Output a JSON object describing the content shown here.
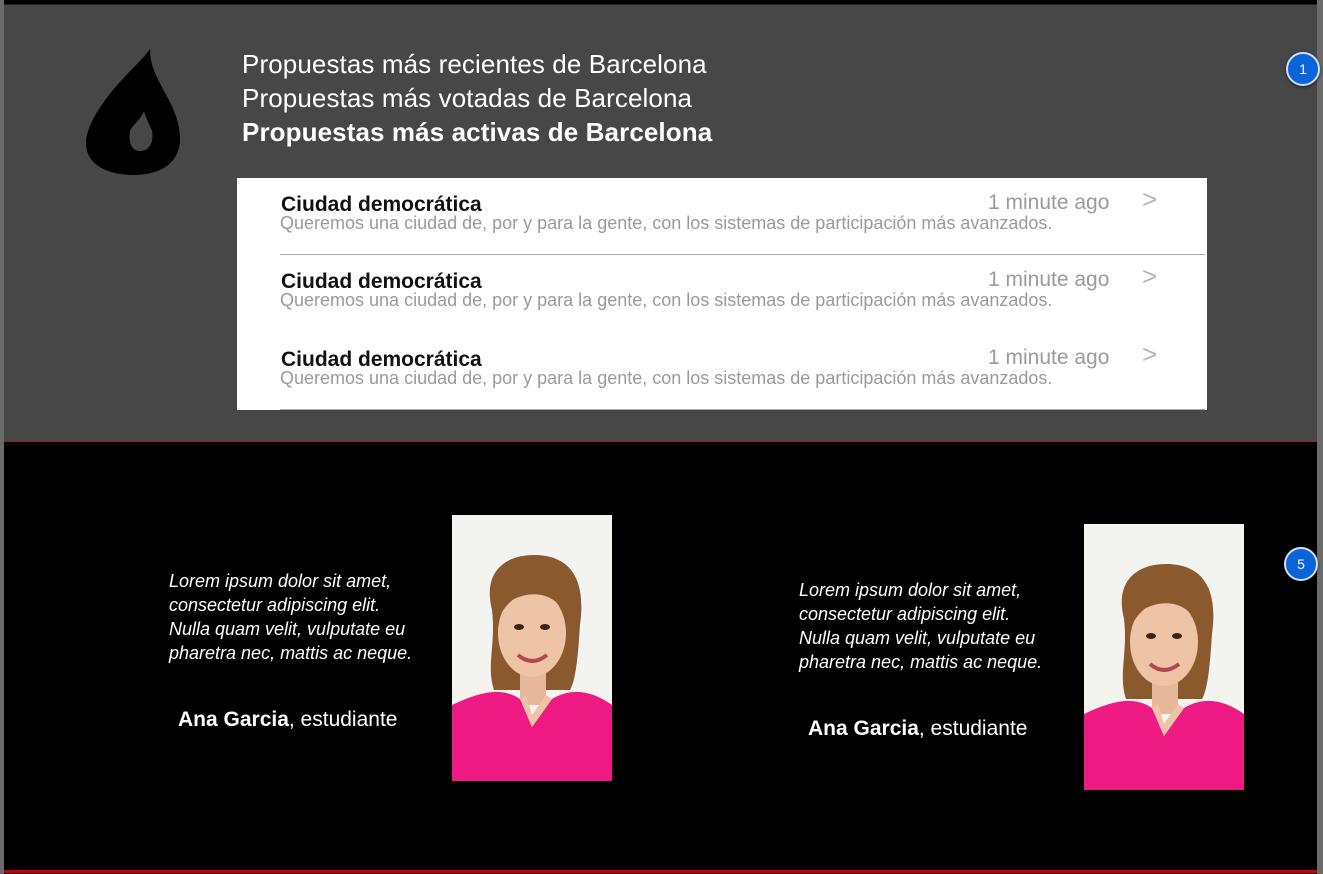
{
  "headings": [
    "Propuestas más recientes de Barcelona",
    "Propuestas más votadas de Barcelona",
    "Propuestas más activas de Barcelona"
  ],
  "proposals": [
    {
      "title": "Ciudad democrática",
      "description": "Queremos una ciudad de, por y para la gente, con los sistemas de participación más avanzados.",
      "time": "1 minute ago"
    },
    {
      "title": "Ciudad democrática",
      "description": "Queremos una ciudad de, por y para la gente, con los sistemas de participación más avanzados.",
      "time": "1 minute ago"
    },
    {
      "title": "Ciudad democrática",
      "description": "Queremos una ciudad de, por y para la gente, con los sistemas de participación más avanzados.",
      "time": "1 minute ago"
    }
  ],
  "arrow": ">",
  "badges": {
    "top": "1",
    "bottom": "5"
  },
  "testimonials": [
    {
      "quote_lines": [
        "Lorem ipsum dolor sit amet,",
        "consectetur adipiscing elit.",
        "Nulla quam velit, vulputate eu",
        "pharetra nec, mattis ac neque."
      ],
      "name": "Ana Garcia",
      "role": ", estudiante"
    },
    {
      "quote_lines": [
        "Lorem ipsum dolor sit amet,",
        "consectetur adipiscing elit.",
        "Nulla quam velit, vulputate eu",
        "pharetra nec, mattis ac neque."
      ],
      "name": "Ana Garcia",
      "role": ", estudiante"
    }
  ],
  "colors": {
    "top_bg": "#474747",
    "badge": "#0b63d9",
    "muted_text": "#9a9a9a"
  }
}
